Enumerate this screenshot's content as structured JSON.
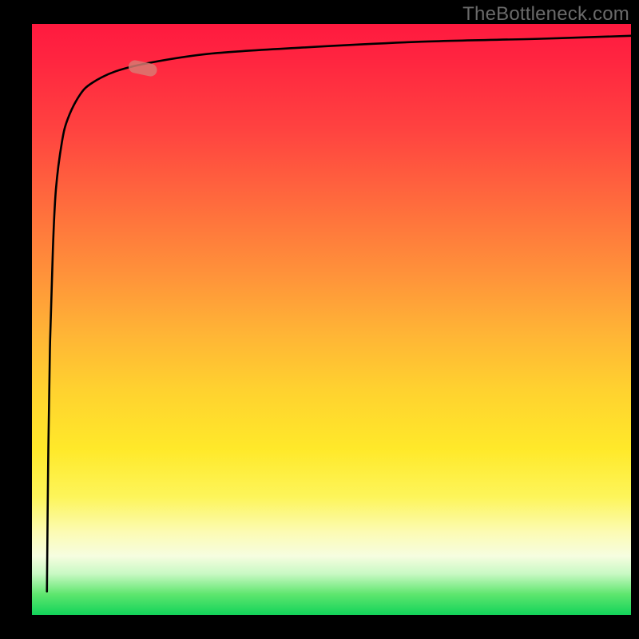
{
  "watermark": "TheBottleneck.com",
  "colors": {
    "background": "#000000",
    "text": "#6a6a6a",
    "curve": "#000000",
    "marker": "#d87c74"
  },
  "chart_data": {
    "type": "line",
    "title": "",
    "xlabel": "",
    "ylabel": "",
    "xlim": [
      0,
      100
    ],
    "ylim": [
      0,
      100
    ],
    "grid": false,
    "legend": false,
    "series": [
      {
        "name": "curve",
        "x": [
          2.5,
          2.7,
          3.0,
          3.5,
          4.0,
          5.0,
          6.0,
          8.0,
          10.0,
          14.0,
          20.0,
          30.0,
          45.0,
          65.0,
          85.0,
          100.0
        ],
        "y": [
          4.0,
          25.0,
          45.0,
          62.0,
          72.0,
          80.0,
          84.0,
          88.0,
          90.0,
          92.0,
          93.5,
          95.0,
          96.0,
          97.0,
          97.5,
          98.0
        ]
      }
    ],
    "marker": {
      "x": 18.5,
      "y": 92.5,
      "shape": "rounded-rect",
      "angle_deg": 12
    },
    "background_gradient": {
      "direction": "vertical",
      "stops": [
        {
          "pos": 0.0,
          "color": "#ff1a3f"
        },
        {
          "pos": 0.3,
          "color": "#ff6a3d"
        },
        {
          "pos": 0.62,
          "color": "#ffd22f"
        },
        {
          "pos": 0.86,
          "color": "#fcfbb4"
        },
        {
          "pos": 1.0,
          "color": "#12d35a"
        }
      ]
    }
  }
}
